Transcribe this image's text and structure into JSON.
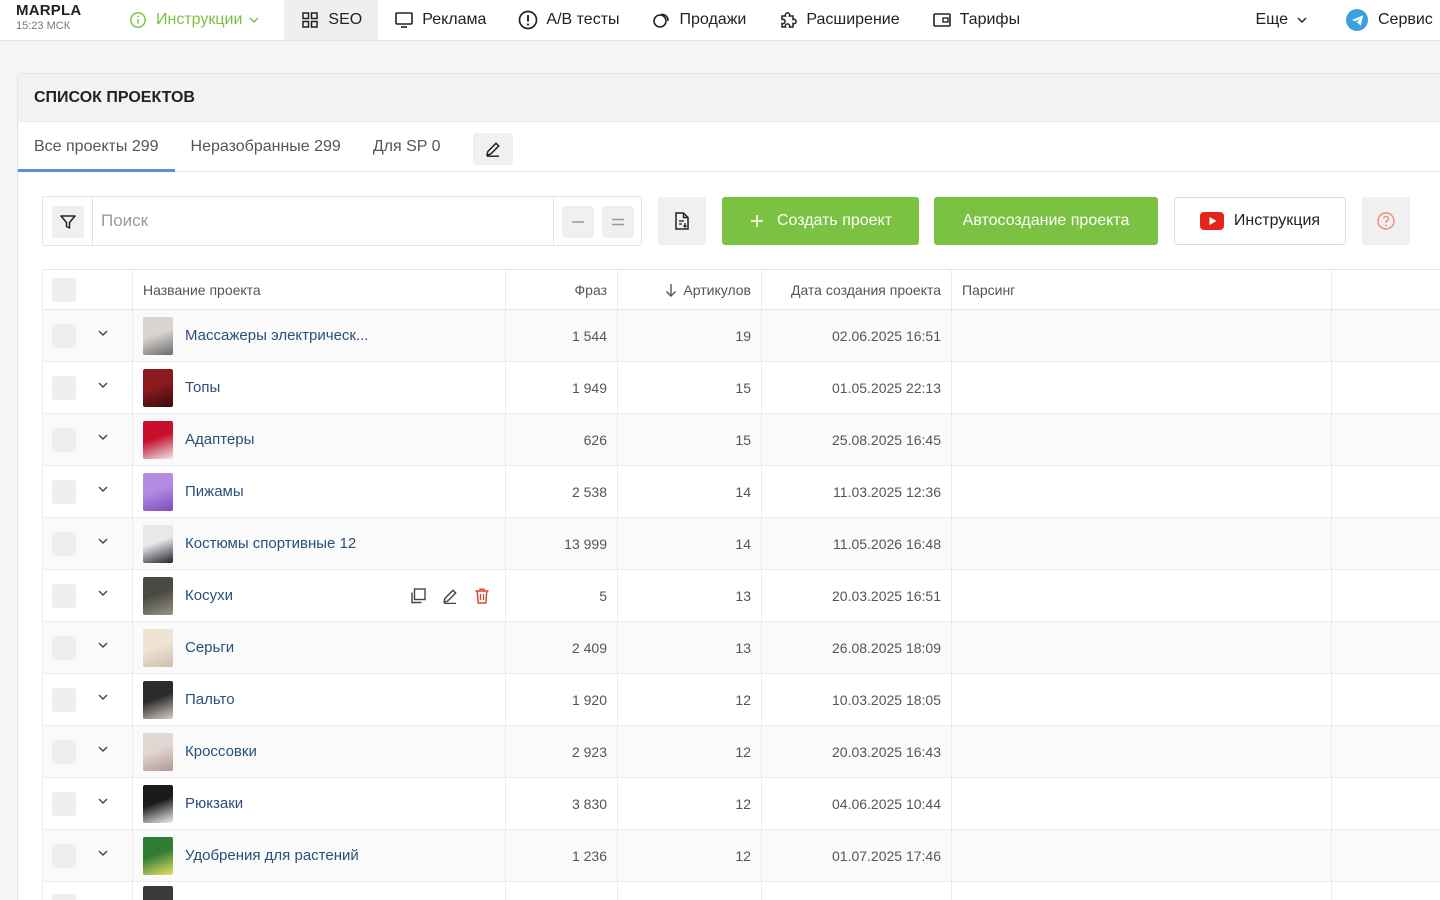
{
  "brand": {
    "name": "MARPLA",
    "time": "15:23 МСК"
  },
  "nav": {
    "instructions": "Инструкции",
    "seo": "SEO",
    "ads": "Реклама",
    "ab": "A/B тесты",
    "sales": "Продажи",
    "extension": "Расширение",
    "tariffs": "Тарифы",
    "more": "Еще",
    "service": "Сервис"
  },
  "card": {
    "title": "СПИСОК ПРОЕКТОВ"
  },
  "tabs": [
    {
      "label": "Все проекты 299"
    },
    {
      "label": "Неразобранные 299"
    },
    {
      "label": "Для SP 0"
    }
  ],
  "search": {
    "placeholder": "Поиск"
  },
  "toolbar": {
    "create": "Создать проект",
    "autocreate": "Автосоздание проекта",
    "instruction": "Инструкция"
  },
  "table": {
    "headers": {
      "name": "Название проекта",
      "phrases": "Фраз",
      "articles": "Артикулов",
      "created": "Дата создания проекта",
      "parsing": "Парсинг"
    },
    "rows": [
      {
        "name": "Массажеры электрическ...",
        "phrases": "1 544",
        "articles": "19",
        "created": "02.06.2025 16:51"
      },
      {
        "name": "Топы",
        "phrases": "1 949",
        "articles": "15",
        "created": "01.05.2025 22:13"
      },
      {
        "name": "Адаптеры",
        "phrases": "626",
        "articles": "15",
        "created": "25.08.2025 16:45"
      },
      {
        "name": "Пижамы",
        "phrases": "2 538",
        "articles": "14",
        "created": "11.03.2025 12:36"
      },
      {
        "name": "Костюмы спортивные 12",
        "phrases": "13 999",
        "articles": "14",
        "created": "11.05.2026 16:48"
      },
      {
        "name": "Косухи",
        "phrases": "5",
        "articles": "13",
        "created": "20.03.2025 16:51"
      },
      {
        "name": "Серьги",
        "phrases": "2 409",
        "articles": "13",
        "created": "26.08.2025 18:09"
      },
      {
        "name": "Пальто",
        "phrases": "1 920",
        "articles": "12",
        "created": "10.03.2025 18:05"
      },
      {
        "name": "Кроссовки",
        "phrases": "2 923",
        "articles": "12",
        "created": "20.03.2025 16:43"
      },
      {
        "name": "Рюкзаки",
        "phrases": "3 830",
        "articles": "12",
        "created": "04.06.2025 10:44"
      },
      {
        "name": "Удобрения для растений",
        "phrases": "1 236",
        "articles": "12",
        "created": "01.07.2025 17:46"
      }
    ]
  },
  "colors": {
    "accent_green": "#7bc142",
    "link": "#2a4f7a",
    "tab_underline": "#5b8fd4",
    "delete_red": "#d94a2a"
  }
}
